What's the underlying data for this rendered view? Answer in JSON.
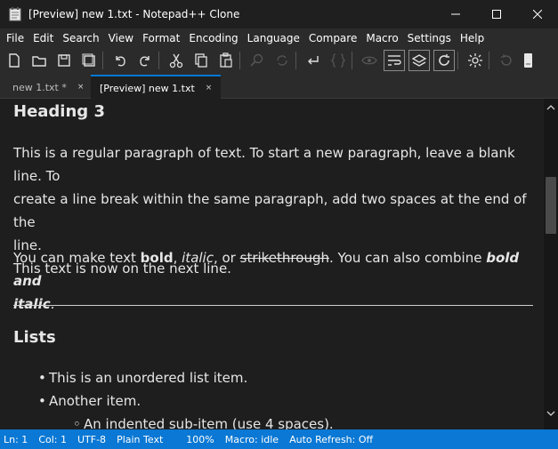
{
  "window": {
    "title": "[Preview] new 1.txt - Notepad++ Clone"
  },
  "menubar": {
    "items": [
      {
        "label": "File"
      },
      {
        "label": "Edit"
      },
      {
        "label": "Search"
      },
      {
        "label": "View"
      },
      {
        "label": "Format"
      },
      {
        "label": "Encoding"
      },
      {
        "label": "Language"
      },
      {
        "label": "Compare"
      },
      {
        "label": "Macro"
      },
      {
        "label": "Settings"
      },
      {
        "label": "Help"
      }
    ]
  },
  "toolbar": {
    "icons": [
      "new-file-icon",
      "open-folder-icon",
      "save-icon",
      "save-all-icon",
      "undo-icon",
      "redo-icon",
      "cut-icon",
      "copy-icon",
      "paste-icon",
      "find-icon",
      "replace-icon",
      "word-wrap-icon",
      "braces-icon",
      "eye-icon",
      "wrap-lines-icon",
      "layers-icon",
      "refresh-icon",
      "theme-sun-icon",
      "reload-icon",
      "scroll-icon"
    ]
  },
  "tabs": [
    {
      "label": "new 1.txt *",
      "close": "×"
    },
    {
      "label": "[Preview] new 1.txt",
      "close": "×"
    }
  ],
  "document": {
    "heading3": "Heading 3",
    "para1_line1": "This is a regular paragraph of text. To start a new paragraph, leave a blank line. To",
    "para1_line2": "create a line break within the same paragraph, add two spaces at the end of the",
    "para1_line3": "line.",
    "para1_line4": "This text is now on the next line.",
    "para2_pre": "You can make text ",
    "para2_bold": "bold",
    "para2_comma1": ", ",
    "para2_italic": "italic",
    "para2_or": ", or ",
    "para2_strike": "strikethrough",
    "para2_mid": ". You can also combine ",
    "para2_bolditalic1": "bold and",
    "para2_bolditalic2": "italic",
    "para2_end": ".",
    "heading2": "Lists",
    "list": [
      "This is an unordered list item.",
      "Another item."
    ],
    "sublist": [
      "An indented sub-item (use 4 spaces)."
    ],
    "bullet": "•",
    "sub_bullet": "◦"
  },
  "statusbar": {
    "ln": "Ln:  1",
    "col": "Col:  1",
    "encoding": "UTF-8",
    "language": "Plain Text",
    "zoom": "100%",
    "macro": "Macro: idle",
    "refresh": "Auto Refresh: Off"
  },
  "colors": {
    "status_bg": "#0a78d4",
    "editor_bg": "#1e1e1e",
    "chrome_bg": "#2b2b2b"
  }
}
